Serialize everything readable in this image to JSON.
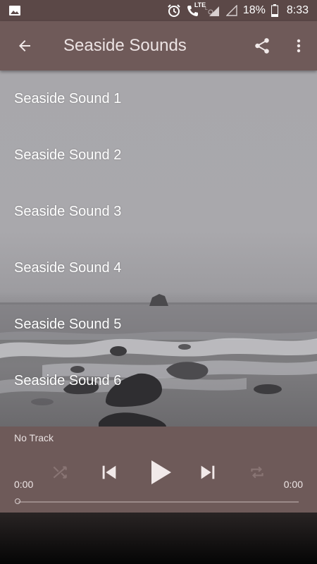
{
  "status_bar": {
    "image_icon": "image-icon",
    "alarm_icon": "alarm-icon",
    "volte_label": "LTE",
    "battery_percent": "18%",
    "time": "8:33"
  },
  "app_bar": {
    "title": "Seaside Sounds",
    "back_icon": "arrow-back-icon",
    "share_icon": "share-icon",
    "menu_icon": "more-vert-icon"
  },
  "tracks": [
    {
      "label": "Seaside Sound 1"
    },
    {
      "label": "Seaside Sound 2"
    },
    {
      "label": "Seaside Sound 3"
    },
    {
      "label": "Seaside Sound 4"
    },
    {
      "label": "Seaside Sound 5"
    },
    {
      "label": "Seaside Sound 6"
    }
  ],
  "player": {
    "now_playing": "No Track",
    "elapsed": "0:00",
    "duration": "0:00",
    "progress": 0
  },
  "colors": {
    "app_bar": "#6f5a59",
    "status_bar": "#5b4847",
    "player": "#6e5a59"
  }
}
